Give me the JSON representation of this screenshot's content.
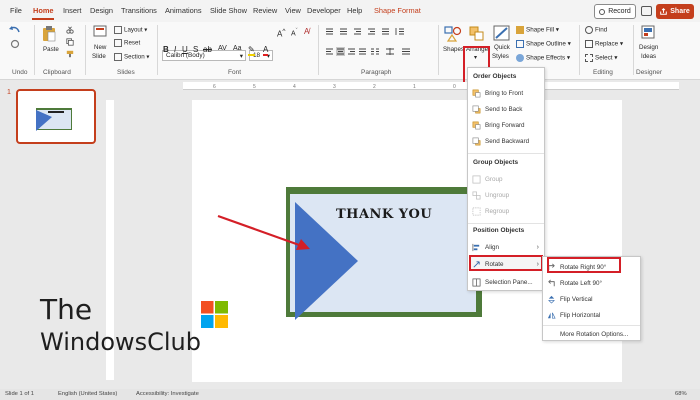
{
  "tabs": [
    "File",
    "Home",
    "Insert",
    "Design",
    "Transitions",
    "Animations",
    "Slide Show",
    "Review",
    "View",
    "Developer",
    "Help",
    "Shape Format"
  ],
  "active_tab": "Home",
  "title_bar": {
    "record_label": "Record",
    "share_label": "Share"
  },
  "ribbon": {
    "undo_group": "Undo",
    "clipboard": {
      "paste": "Paste",
      "label": "Clipboard"
    },
    "slides": {
      "new_slide": "New",
      "new_slide2": "Slide",
      "layout": "Layout",
      "reset": "Reset",
      "section": "Section",
      "label": "Slides"
    },
    "font": {
      "family": "Calibri (Body)",
      "size": "18",
      "label": "Font"
    },
    "paragraph": {
      "label": "Paragraph"
    },
    "drawing": {
      "shapes": "Shapes",
      "arrange": "Arrange",
      "quick_styles": "Quick",
      "quick_styles2": "Styles",
      "shape_fill": "Shape Fill",
      "shape_outline": "Shape Outline",
      "shape_effects": "Shape Effects"
    },
    "editing": {
      "find": "Find",
      "replace": "Replace",
      "select": "Select",
      "label": "Editing"
    },
    "designer": {
      "design_ideas": "Design",
      "design_ideas2": "Ideas",
      "label": "Designer"
    }
  },
  "thumbnail": {
    "slide_number": "1"
  },
  "slide": {
    "text": "THANK YOU"
  },
  "arrange_menu": {
    "order_header": "Order Objects",
    "bring_to_front": "Bring to Front",
    "send_to_back": "Send to Back",
    "bring_forward": "Bring Forward",
    "send_backward": "Send Backward",
    "group_header": "Group Objects",
    "group": "Group",
    "ungroup": "Ungroup",
    "regroup": "Regroup",
    "position_header": "Position Objects",
    "align": "Align",
    "rotate": "Rotate",
    "selection_pane": "Selection Pane..."
  },
  "rotate_menu": {
    "rotate_right": "Rotate Right 90°",
    "rotate_left": "Rotate Left 90°",
    "flip_vertical": "Flip Vertical",
    "flip_horizontal": "Flip Horizontal",
    "more": "More Rotation Options..."
  },
  "watermark": {
    "line1": "The",
    "line2": "WindowsClub"
  },
  "status_bar": {
    "slide_info": "Slide 1 of 1",
    "language": "English (United States)",
    "accessibility": "Accessibility: Investigate",
    "zoom": "68%"
  },
  "colors": {
    "accent": "#c43e1c",
    "highlight_box": "#d41f27",
    "triangle": "#4472c4",
    "rect_border": "#4e7a3a",
    "rect_fill": "#dce6f3"
  }
}
